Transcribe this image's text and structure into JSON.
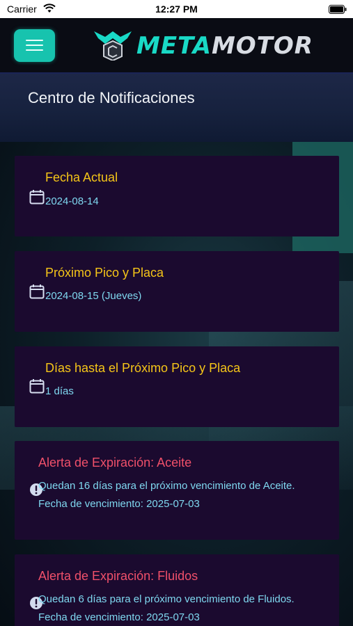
{
  "status_bar": {
    "carrier": "Carrier",
    "time": "12:27 PM"
  },
  "header": {
    "logo_part1": "META",
    "logo_part2": "MOTOR",
    "menu_icon": "hamburger-menu-icon",
    "accent_color": "#17c3ae"
  },
  "page": {
    "title": "Centro de Notificaciones"
  },
  "cards": [
    {
      "type": "info",
      "title": "Fecha Actual",
      "text": "2024-08-14",
      "icon": "calendar-icon"
    },
    {
      "type": "info",
      "title": "Próximo Pico y Placa",
      "text": "2024-08-15 (Jueves)",
      "icon": "calendar-icon"
    },
    {
      "type": "info",
      "title": "Días hasta el Próximo Pico y Placa",
      "text": "1 días",
      "icon": "calendar-icon"
    },
    {
      "type": "alert",
      "title": "Alerta de Expiración: Aceite",
      "line1": "Quedan 16 días para el próximo vencimiento de Aceite.",
      "line2": "Fecha de vencimiento: 2025-07-03",
      "icon": "alert-circle-icon"
    },
    {
      "type": "alert",
      "title": "Alerta de Expiración: Fluidos",
      "line1": "Quedan 6 días para el próximo vencimiento de Fluidos.",
      "line2": "Fecha de vencimiento: 2025-07-03",
      "icon": "alert-circle-icon"
    }
  ],
  "colors": {
    "info_title": "#f5c518",
    "alert_title": "#f0506a",
    "body_text": "#7fd8f0",
    "card_bg": "#1b0a2f"
  }
}
